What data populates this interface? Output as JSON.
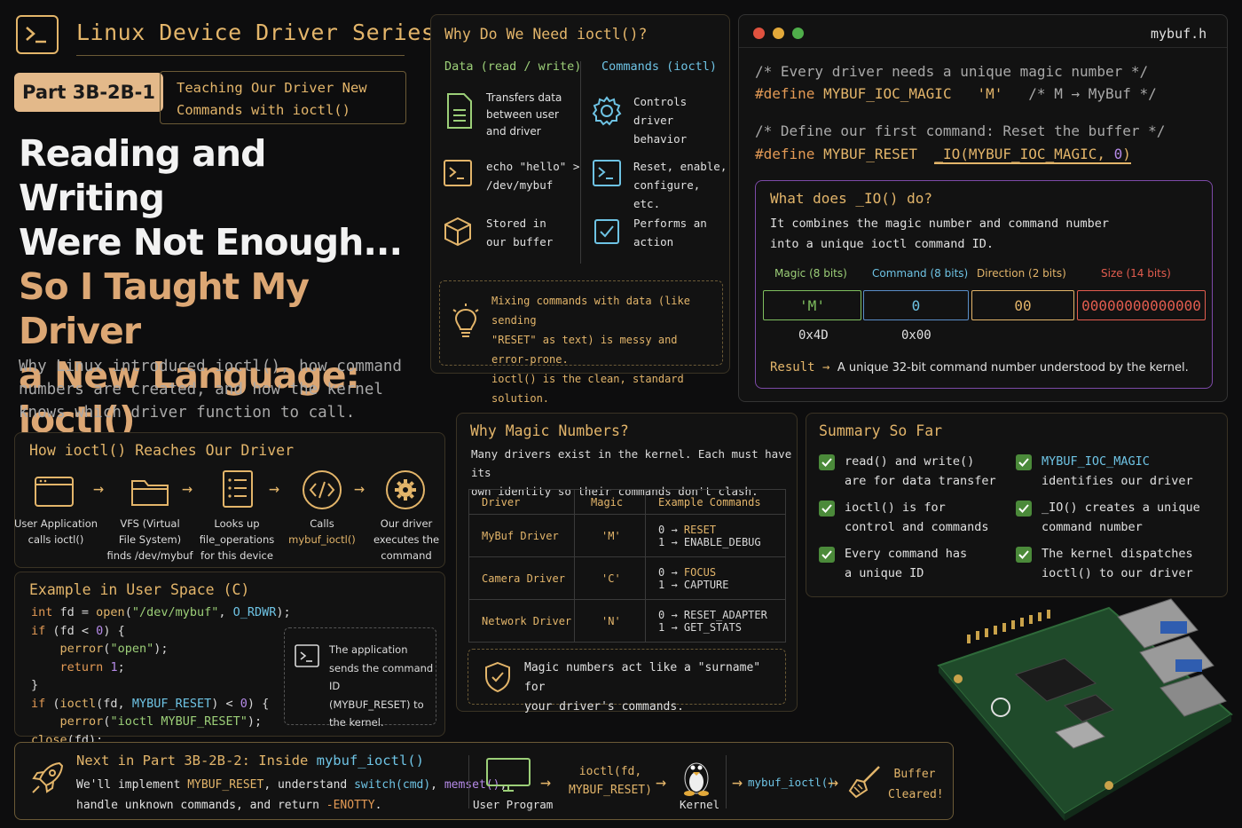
{
  "header": {
    "series": "Linux Device Driver Series",
    "part_badge": "Part 3B-2B-1",
    "part_desc_1": "Teaching Our Driver New",
    "part_desc_2": "Commands with ioctl()",
    "headline_1": "Reading and Writing",
    "headline_2": "Were Not Enough...",
    "headline_3": "So I Taught My Driver",
    "headline_4": "a New Language:",
    "headline_5": "ioctl()",
    "subtitle_1": "Why Linux introduced ioctl(), how command",
    "subtitle_2": "numbers are created, and how the kernel",
    "subtitle_3": "knows which driver function to call."
  },
  "reach": {
    "title": "How ioctl() Reaches Our Driver",
    "steps": [
      {
        "l1": "User Application",
        "l2": "calls ioctl()",
        "l3": ""
      },
      {
        "l1": "VFS (Virtual",
        "l2": "File System)",
        "l3": "finds /dev/mybuf"
      },
      {
        "l1": "Looks up",
        "l2": "file_operations",
        "l3": "for this device"
      },
      {
        "l1": "Calls",
        "l2": "mybuf_ioctl()",
        "l3": ""
      },
      {
        "l1": "Our driver",
        "l2": "executes the",
        "l3": "command"
      }
    ]
  },
  "example": {
    "title": "Example in User Space (C)",
    "note_1": "The application",
    "note_2": "sends the command ID",
    "note_3": "(MYBUF_RESET) to",
    "note_4": "the kernel."
  },
  "need": {
    "title": "Why Do We Need ioctl()?",
    "col_data": "Data (read / write)",
    "col_cmd": "Commands (ioctl)",
    "data_1a": "Transfers data",
    "data_1b": "between user",
    "data_1c": "and driver",
    "data_2a": "echo \"hello\" >",
    "data_2b": "/dev/mybuf",
    "data_3a": "Stored in",
    "data_3b": "our buffer",
    "cmd_1a": "Controls driver",
    "cmd_1b": "behavior",
    "cmd_2a": "Reset, enable,",
    "cmd_2b": "configure, etc.",
    "cmd_3a": "Performs an",
    "cmd_3b": "action",
    "tip_1": "Mixing commands with data (like sending",
    "tip_2": "\"RESET\" as text) is messy and error-prone.",
    "tip_3": "ioctl() is the clean, standard solution."
  },
  "header_file": {
    "filename": "mybuf.h",
    "comment_1": "/* Every driver needs a unique magic number */",
    "define": "#define",
    "magic_name": "MYBUF_IOC_MAGIC",
    "magic_val": "'M'",
    "magic_comment": "/* M → MyBuf */",
    "comment_2": "/* Define our first command: Reset the buffer */",
    "reset_name": "MYBUF_RESET",
    "io_macro": "_IO",
    "io_args": "(MYBUF_IOC_MAGIC, ",
    "io_num": "0",
    "io_close": ")"
  },
  "io_explain": {
    "title": "What does _IO() do?",
    "desc_1": "It combines the magic number and command number",
    "desc_2": "into a unique ioctl command ID.",
    "f_magic": "Magic (8 bits)",
    "f_cmd": "Command (8 bits)",
    "f_dir": "Direction (2 bits)",
    "f_size": "Size (14 bits)",
    "v_magic": "'M'",
    "v_cmd": "0",
    "v_dir": "00",
    "v_size": "00000000000000",
    "hex_magic": "0x4D",
    "hex_cmd": "0x00",
    "result_label": "Result",
    "result_text": "A unique 32-bit command number understood by the kernel.",
    "colors": {
      "magic": "#7fbf5f",
      "cmd": "#5a8ec8",
      "dir": "#e3b56a",
      "size": "#e35d4f"
    }
  },
  "magic": {
    "title": "Why Magic Numbers?",
    "desc_1": "Many drivers exist in the kernel. Each must have its",
    "desc_2": "own identity so their commands don't clash.",
    "headers": [
      "Driver",
      "Magic",
      "Example Commands"
    ],
    "rows": [
      {
        "driver": "MyBuf Driver",
        "magic": "'M'",
        "c1n": "0",
        "c1": "RESET",
        "c2n": "1",
        "c2": "ENABLE_DEBUG"
      },
      {
        "driver": "Camera Driver",
        "magic": "'C'",
        "c1n": "0",
        "c1": "FOCUS",
        "c2n": "1",
        "c2": "CAPTURE"
      },
      {
        "driver": "Network Driver",
        "magic": "'N'",
        "c1n": "0",
        "c1": "RESET_ADAPTER",
        "c2n": "1",
        "c2": "GET_STATS"
      }
    ],
    "note_1": "Magic numbers act like a \"surname\" for",
    "note_2": "your driver's commands."
  },
  "summary": {
    "title": "Summary So Far",
    "items": [
      {
        "a": "read() and write()",
        "b": "are for data transfer"
      },
      {
        "a": "ioctl() is for",
        "b": "control and commands"
      },
      {
        "a": "Every command has",
        "b": "a unique ID"
      },
      {
        "a": "MYBUF_IOC_MAGIC",
        "b": "identifies our driver"
      },
      {
        "a": "_IO() creates a unique",
        "b": "command number"
      },
      {
        "a": "The kernel dispatches",
        "b": "ioctl() to our driver"
      }
    ]
  },
  "next": {
    "title_a": "Next in Part 3B-2B-2: Inside ",
    "title_b": "mybuf_ioctl()",
    "l1_a": "We'll implement ",
    "l1_b": "MYBUF_RESET",
    "l1_c": ", understand ",
    "l1_d": "switch(cmd)",
    "l1_e": ", ",
    "l1_f": "memset()",
    "l1_g": ",",
    "l2_a": "handle unknown commands, and return ",
    "l2_b": "-ENOTTY",
    "l2_c": ".",
    "user_program": "User Program",
    "call_1": "ioctl(fd,",
    "call_2": "MYBUF_RESET)",
    "kernel": "Kernel",
    "handler": "mybuf_ioctl()",
    "done_1": "Buffer",
    "done_2": "Cleared!"
  }
}
